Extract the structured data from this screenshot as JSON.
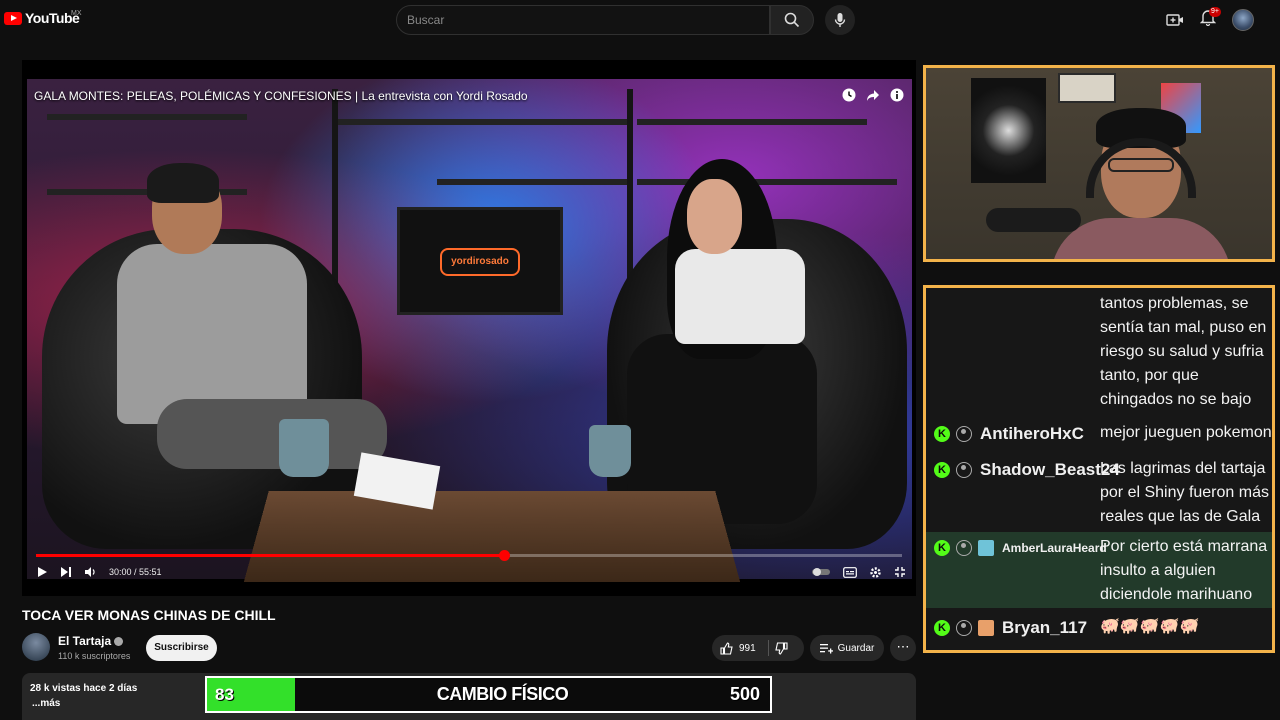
{
  "topbar": {
    "logo_text": "YouTube",
    "logo_country": "MX",
    "search_placeholder": "Buscar",
    "notifications_badge": "9+"
  },
  "player": {
    "video_title": "GALA MONTES: PELEAS, POLÉMICAS Y CONFESIONES | La entrevista con Yordi Rosado",
    "tv_logo_text": "yordirosado",
    "time_current": "30:00",
    "time_total": "55:51",
    "time_display": "30:00 / 55:51",
    "progress_fraction": 0.54
  },
  "video": {
    "title": "TOCA VER MONAS CHINAS DE CHILL",
    "channel_name": "El Tartaja",
    "subscribers": "110 k suscriptores",
    "subscribe_label": "Suscribirse",
    "likes": "991",
    "save_label": "Guardar",
    "views_date": "28 k vistas  hace 2 días",
    "more_label": "...más"
  },
  "overlay_bar": {
    "left_value": "83",
    "label": "CAMBIO FÍSICO",
    "right_value": "500",
    "fill_fraction": 0.166,
    "fill_color": "#33e02a"
  },
  "chat": {
    "messages": [
      {
        "username": "",
        "text": "tantos problemas, se sentía tan mal, puso en riesgo su salud y sufria tanto, por que chingados no se bajo"
      },
      {
        "username": "AntiheroHxC",
        "text": "mejor jueguen pokemon"
      },
      {
        "username": "Shadow_Beast24",
        "text": "Las lagrimas del tartaja por el Shiny fueron más reales que las de Gala"
      },
      {
        "username": "AmberLauraHeard",
        "text": "Por cierto está marrana insulto a alguien diciendole marihuano"
      },
      {
        "username": "Bryan_117",
        "text": "🐖🐖🐖🐖🐖"
      }
    ],
    "kick_badge": "K",
    "border_color": "#f3b34a"
  }
}
